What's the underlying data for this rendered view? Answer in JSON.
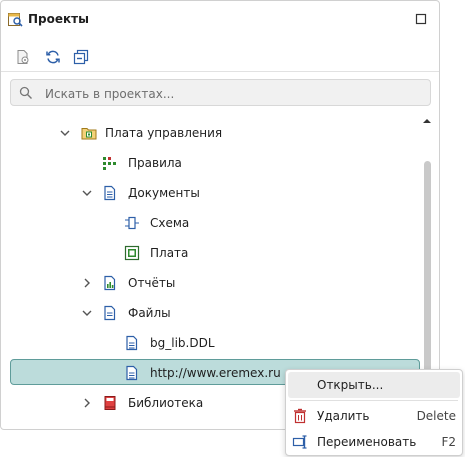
{
  "panel": {
    "title": "Проекты",
    "title_icon": "projects-icon",
    "maximize_icon": "maximize-icon"
  },
  "toolbar": {
    "buttons": [
      {
        "name": "project-settings-icon"
      },
      {
        "name": "refresh-icon"
      },
      {
        "name": "collapse-all-icon"
      }
    ]
  },
  "search": {
    "placeholder": "Искать в проектах...",
    "value": ""
  },
  "tree": {
    "items": [
      {
        "label": "Плата управления",
        "icon": "board-folder-icon",
        "expanded": true
      },
      {
        "label": "Правила",
        "icon": "rules-icon"
      },
      {
        "label": "Документы",
        "icon": "documents-icon",
        "expanded": true
      },
      {
        "label": "Схема",
        "icon": "schematic-icon"
      },
      {
        "label": "Плата",
        "icon": "pcb-icon"
      },
      {
        "label": "Отчёты",
        "icon": "reports-icon",
        "expanded": false
      },
      {
        "label": "Файлы",
        "icon": "files-icon",
        "expanded": true
      },
      {
        "label": "bg_lib.DDL",
        "icon": "file-icon"
      },
      {
        "label": "http://www.eremex.ru",
        "icon": "file-icon",
        "selected": true
      },
      {
        "label": "Библиотека",
        "icon": "library-icon",
        "expanded": false
      }
    ]
  },
  "context_menu": {
    "items": [
      {
        "label": "Открыть...",
        "shortcut": "",
        "icon": ""
      },
      {
        "label": "Удалить",
        "shortcut": "Delete",
        "icon": "delete-icon"
      },
      {
        "label": "Переименовать",
        "shortcut": "F2",
        "icon": "rename-icon"
      }
    ]
  },
  "colors": {
    "selection_bg": "#bcdcdb",
    "selection_border": "#5f9c9a",
    "icon_blue": "#2d5fa8",
    "icon_green": "#2e8b2e",
    "icon_red": "#c03030"
  }
}
